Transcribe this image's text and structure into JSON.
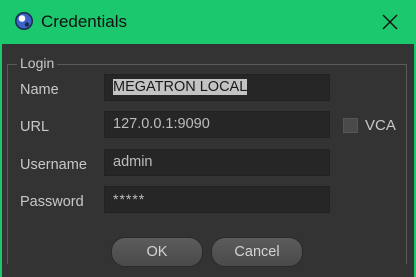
{
  "window": {
    "title": "Credentials",
    "app_icon": "cinema4d-sphere-icon",
    "close_icon": "close-icon",
    "titlebar_color": "#1bc86e"
  },
  "group": {
    "label": "Login"
  },
  "fields": {
    "name": {
      "label": "Name",
      "value": "MEGATRON LOCAL",
      "selected": true
    },
    "url": {
      "label": "URL",
      "value": "127.0.0.1:9090"
    },
    "username": {
      "label": "Username",
      "value": "admin"
    },
    "password": {
      "label": "Password",
      "value": "*****"
    }
  },
  "vca": {
    "label": "VCA",
    "checked": false
  },
  "buttons": {
    "ok_label": "OK",
    "cancel_label": "Cancel"
  }
}
